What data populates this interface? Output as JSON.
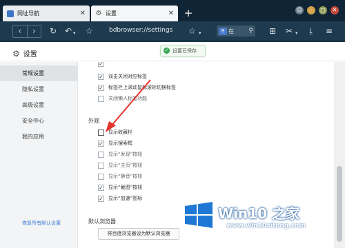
{
  "tabs": [
    {
      "label": "网址导航",
      "close": "✕",
      "favicon": "bookmark-icon"
    },
    {
      "label": "设置",
      "close": "✕",
      "favicon": "gear-icon"
    }
  ],
  "new_tab": "+",
  "window_controls": {
    "skin": "☺",
    "minimize": "–",
    "maximize": "□",
    "close": "✕"
  },
  "toolbar": {
    "back": "‹",
    "forward": "›",
    "refresh": "↻",
    "undo": "↶",
    "undo_caret": "▾",
    "favorite": "☆",
    "address": "bdbrowser://settings",
    "star": "☆",
    "star_caret": "▾",
    "search_engine": "8",
    "search_text": "在",
    "search_icon": "⚲",
    "apps": "⊞",
    "cut": "✂",
    "cut_caret": "▾",
    "download": "⤓",
    "menu": "≡"
  },
  "header": {
    "gear": "⚙",
    "title": "设置",
    "toast_icon": "✓",
    "toast_text": "设置已保存"
  },
  "sidebar": {
    "items": [
      {
        "label": "常规设置",
        "active": true
      },
      {
        "label": "隐私设置",
        "active": false
      },
      {
        "label": "高级设置",
        "active": false
      },
      {
        "label": "安全中心",
        "active": false
      },
      {
        "label": "我的应用",
        "active": false
      }
    ],
    "reset": "恢复所有默认设置"
  },
  "tab_options": [
    {
      "label": "双击关闭对应标签",
      "checked": true
    },
    {
      "label": "标签栏上滚动鼠标滚轮切换标签",
      "checked": true
    },
    {
      "label": "关闭懒人标签功能",
      "checked": false
    }
  ],
  "appearance": {
    "title": "外观",
    "options": [
      {
        "label": "显示收藏栏",
        "checked": false
      },
      {
        "label": "显示搜索框",
        "checked": true
      },
      {
        "label": "显示“发现”按钮",
        "checked": false
      },
      {
        "label": "显示“主页”按钮",
        "checked": false
      },
      {
        "label": "显示“静音”按钮",
        "checked": false
      },
      {
        "label": "显示“截图”按钮",
        "checked": true
      },
      {
        "label": "显示“加速”图标",
        "checked": true
      }
    ]
  },
  "default_browser": {
    "title": "默认浏览器",
    "button": "将百度浏览器设为默认浏览器"
  },
  "watermark": {
    "title": "Win10 之家",
    "url": "www.win10xitong.com"
  },
  "colors": {
    "accent_blue": "#3a7bd5",
    "toast_green": "#3aa655",
    "arrow_red": "#e5322d",
    "win_logo": "#1e78d4"
  }
}
